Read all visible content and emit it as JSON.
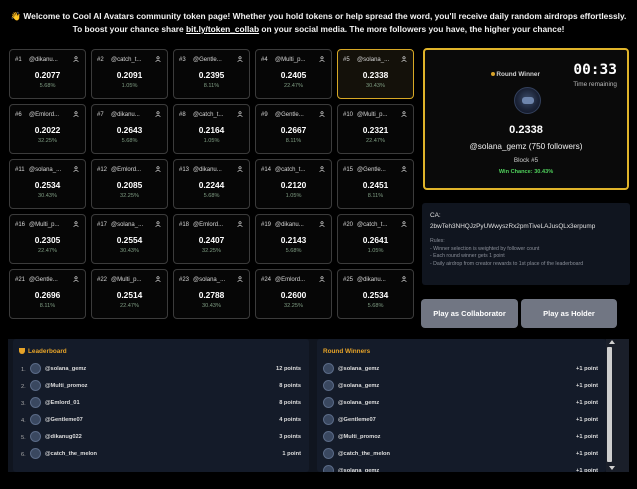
{
  "banner": {
    "emoji": "👋",
    "line1": "Welcome to Cool AI Avatars community token page! Whether you hold tokens or help spread the word, you'll receive daily random airdrops effortlessly.",
    "line2_prefix": "To boost your chance share ",
    "line2_link": "bit.ly/token_collab",
    "line2_suffix": " on your social media. The more followers you have, the higher your chance!"
  },
  "blocks": [
    {
      "num": "#1",
      "name": "@dikanu...",
      "value": "0.2077",
      "pct": "5.68%"
    },
    {
      "num": "#2",
      "name": "@catch_t...",
      "value": "0.2091",
      "pct": "1.05%"
    },
    {
      "num": "#3",
      "name": "@Gentle...",
      "value": "0.2395",
      "pct": "8.11%"
    },
    {
      "num": "#4",
      "name": "@Multi_p...",
      "value": "0.2405",
      "pct": "22.47%"
    },
    {
      "num": "#5",
      "name": "@solana_...",
      "value": "0.2338",
      "pct": "30.43%"
    },
    {
      "num": "#6",
      "name": "@Emlord...",
      "value": "0.2022",
      "pct": "32.25%"
    },
    {
      "num": "#7",
      "name": "@dikanu...",
      "value": "0.2643",
      "pct": "5.68%"
    },
    {
      "num": "#8",
      "name": "@catch_t...",
      "value": "0.2164",
      "pct": "1.05%"
    },
    {
      "num": "#9",
      "name": "@Gentle...",
      "value": "0.2667",
      "pct": "8.11%"
    },
    {
      "num": "#10",
      "name": "@Multi_p...",
      "value": "0.2321",
      "pct": "22.47%"
    },
    {
      "num": "#11",
      "name": "@solana_...",
      "value": "0.2534",
      "pct": "30.43%"
    },
    {
      "num": "#12",
      "name": "@Emlord...",
      "value": "0.2085",
      "pct": "32.25%"
    },
    {
      "num": "#13",
      "name": "@dikanu...",
      "value": "0.2244",
      "pct": "5.68%"
    },
    {
      "num": "#14",
      "name": "@catch_t...",
      "value": "0.2120",
      "pct": "1.05%"
    },
    {
      "num": "#15",
      "name": "@Gentle...",
      "value": "0.2451",
      "pct": "8.11%"
    },
    {
      "num": "#16",
      "name": "@Multi_p...",
      "value": "0.2305",
      "pct": "22.47%"
    },
    {
      "num": "#17",
      "name": "@solana_...",
      "value": "0.2554",
      "pct": "30.43%"
    },
    {
      "num": "#18",
      "name": "@Emlord...",
      "value": "0.2407",
      "pct": "32.25%"
    },
    {
      "num": "#19",
      "name": "@dikanu...",
      "value": "0.2143",
      "pct": "5.68%"
    },
    {
      "num": "#20",
      "name": "@catch_t...",
      "value": "0.2641",
      "pct": "1.05%"
    },
    {
      "num": "#21",
      "name": "@Gentle...",
      "value": "0.2696",
      "pct": "8.11%"
    },
    {
      "num": "#22",
      "name": "@Multi_p...",
      "value": "0.2514",
      "pct": "22.47%"
    },
    {
      "num": "#23",
      "name": "@solana_...",
      "value": "0.2788",
      "pct": "30.43%"
    },
    {
      "num": "#24",
      "name": "@Emlord...",
      "value": "0.2600",
      "pct": "32.25%"
    },
    {
      "num": "#25",
      "name": "@dikanu...",
      "value": "0.2534",
      "pct": "5.68%"
    }
  ],
  "winner_block_index": 4,
  "round_winner": {
    "label": "Round Winner",
    "timer": "00:33",
    "timer_label": "Time remaining",
    "value": "0.2338",
    "user": "@solana_gemz (750 followers)",
    "block": "Block #5",
    "chance": "Win Chance: 30.43%"
  },
  "ca": {
    "label": "CA:",
    "address": "2bwTeh3NHQJzPyUWwyszRx2pmTiveLAJusQLx3erpump",
    "rules_title": "Rules:",
    "rules": [
      "- Winner selection is weighted by follower count",
      "- Each round winner gets 1 point",
      "- Daily airdrop from creator rewards to 1st place of the leaderboard"
    ]
  },
  "buttons": {
    "collaborator": "Play as Collaborator",
    "holder": "Play as Holder"
  },
  "leaderboard": {
    "title": "Leaderboard",
    "rows": [
      {
        "rank": "1.",
        "name": "@solana_gemz",
        "points": "12 points"
      },
      {
        "rank": "2.",
        "name": "@Multi_promoz",
        "points": "8 points"
      },
      {
        "rank": "3.",
        "name": "@Emlord_01",
        "points": "8 points"
      },
      {
        "rank": "4.",
        "name": "@Gentleme07",
        "points": "4 points"
      },
      {
        "rank": "5.",
        "name": "@dikanug022",
        "points": "3 points"
      },
      {
        "rank": "6.",
        "name": "@catch_the_melon",
        "points": "1 point"
      }
    ]
  },
  "round_winners": {
    "title": "Round Winners",
    "rows": [
      {
        "name": "@solana_gemz",
        "points": "+1 point"
      },
      {
        "name": "@solana_gemz",
        "points": "+1 point"
      },
      {
        "name": "@solana_gemz",
        "points": "+1 point"
      },
      {
        "name": "@Gentleme07",
        "points": "+1 point"
      },
      {
        "name": "@Multi_promoz",
        "points": "+1 point"
      },
      {
        "name": "@catch_the_melon",
        "points": "+1 point"
      },
      {
        "name": "@solana_gemz",
        "points": "+1 point"
      }
    ]
  },
  "colors": {
    "accent_gold": "#e0b42a",
    "win_green": "#4fd05b",
    "button_gray": "#717683",
    "panel_navy": "#141b29"
  }
}
